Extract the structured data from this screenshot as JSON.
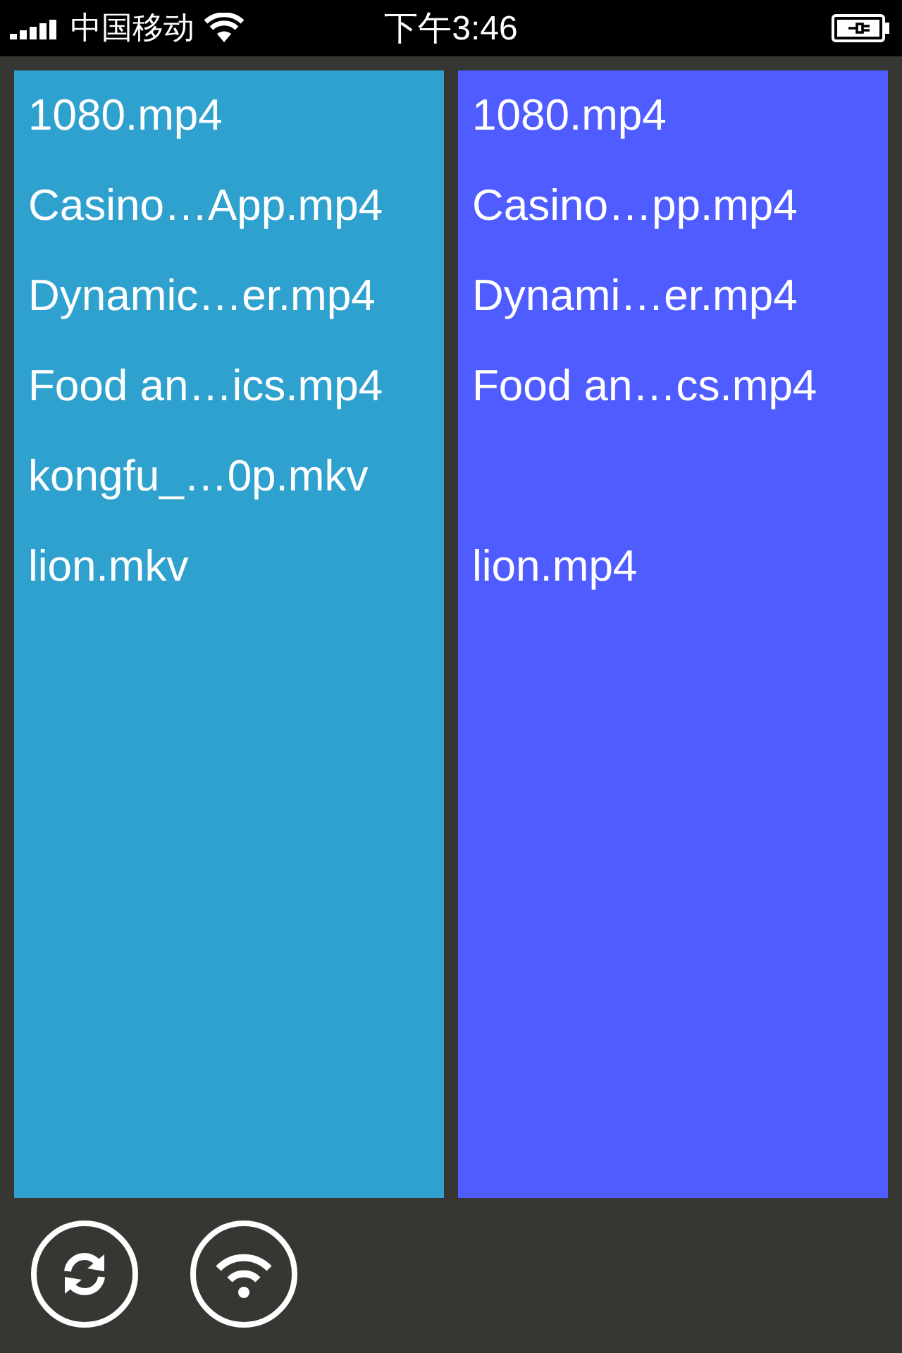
{
  "status_bar": {
    "carrier": "中国移动",
    "time": "下午3:46"
  },
  "lists": [
    {
      "items": [
        {
          "kind": "file",
          "name": "1080.mp4"
        },
        {
          "kind": "file",
          "name": "Casino…App.mp4"
        },
        {
          "kind": "file",
          "name": "Dynamic…er.mp4"
        },
        {
          "kind": "file",
          "name": "Food an…ics.mp4"
        },
        {
          "kind": "file",
          "name": "kongfu_…0p.mkv"
        },
        {
          "kind": "file",
          "name": "lion.mkv"
        }
      ]
    },
    {
      "items": [
        {
          "kind": "file",
          "name": "1080.mp4"
        },
        {
          "kind": "file",
          "name": "Casino…pp.mp4"
        },
        {
          "kind": "file",
          "name": "Dynami…er.mp4"
        },
        {
          "kind": "file",
          "name": "Food an…cs.mp4"
        },
        {
          "kind": "blank"
        },
        {
          "kind": "file",
          "name": "lion.mp4"
        }
      ]
    }
  ],
  "toolbar": [
    {
      "kind": "refresh"
    },
    {
      "kind": "wifi"
    }
  ]
}
